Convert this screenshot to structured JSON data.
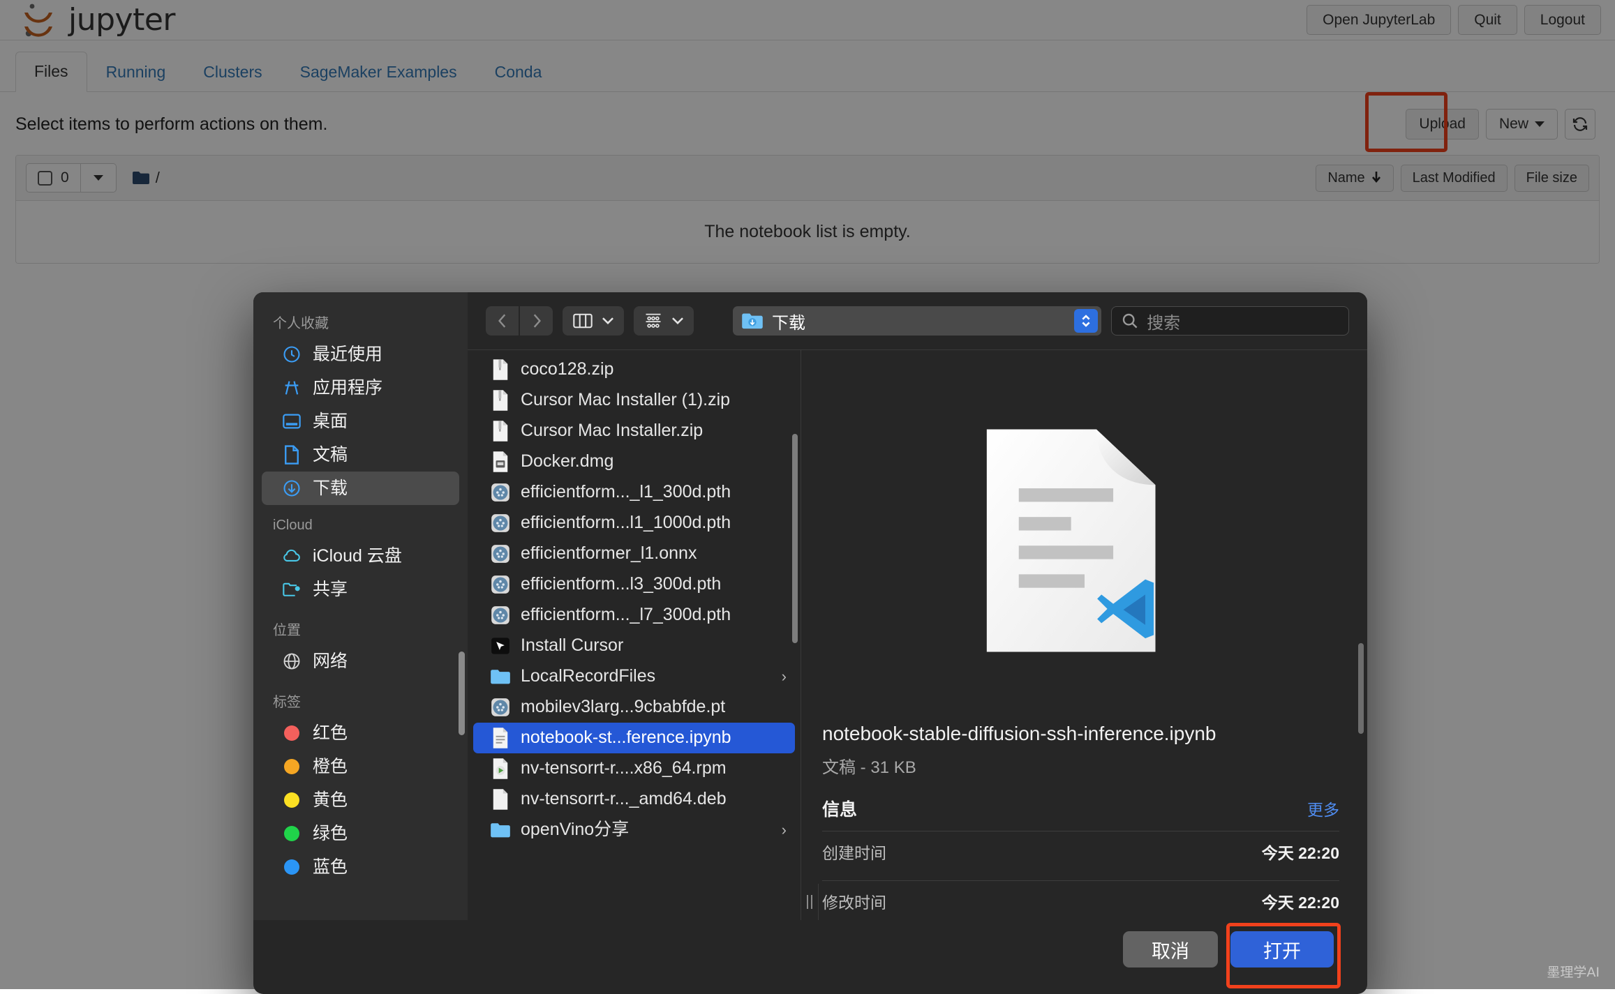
{
  "jupyter": {
    "brand": "jupyter",
    "header_buttons": [
      {
        "label": "Open JupyterLab",
        "name": "open-jupyterlab-button"
      },
      {
        "label": "Quit",
        "name": "quit-button"
      },
      {
        "label": "Logout",
        "name": "logout-button"
      }
    ],
    "tabs": [
      {
        "label": "Files",
        "active": true
      },
      {
        "label": "Running",
        "active": false
      },
      {
        "label": "Clusters",
        "active": false
      },
      {
        "label": "SageMaker Examples",
        "active": false
      },
      {
        "label": "Conda",
        "active": false
      }
    ],
    "hint": "Select items to perform actions on them.",
    "upload_label": "Upload",
    "new_label": "New",
    "refresh_icon": "refresh-icon",
    "selection_count": "0",
    "breadcrumb_path": "/",
    "sort_buttons": [
      {
        "label": "Name",
        "sorted": true
      },
      {
        "label": "Last Modified",
        "sorted": false
      },
      {
        "label": "File size",
        "sorted": false
      }
    ],
    "empty_message": "The notebook list is empty.",
    "highlight_color": "#f1411c"
  },
  "dialog": {
    "sidebar": {
      "groups": [
        {
          "title": "个人收藏",
          "items": [
            {
              "label": "最近使用",
              "icon": "clock-icon",
              "selected": false
            },
            {
              "label": "应用程序",
              "icon": "applications-icon",
              "selected": false
            },
            {
              "label": "桌面",
              "icon": "desktop-icon",
              "selected": false
            },
            {
              "label": "文稿",
              "icon": "document-icon",
              "selected": false
            },
            {
              "label": "下载",
              "icon": "download-icon",
              "selected": true
            }
          ]
        },
        {
          "title": "iCloud",
          "items": [
            {
              "label": "iCloud 云盘",
              "icon": "cloud-icon",
              "selected": false
            },
            {
              "label": "共享",
              "icon": "shared-folder-icon",
              "selected": false
            }
          ]
        },
        {
          "title": "位置",
          "items": [
            {
              "label": "网络",
              "icon": "globe-icon",
              "selected": false
            }
          ]
        },
        {
          "title": "标签",
          "items": [
            {
              "label": "红色",
              "icon": "tag-dot",
              "color": "#f4605c",
              "selected": false
            },
            {
              "label": "橙色",
              "icon": "tag-dot",
              "color": "#f5a623",
              "selected": false
            },
            {
              "label": "黄色",
              "icon": "tag-dot",
              "color": "#fbe023",
              "selected": false
            },
            {
              "label": "绿色",
              "icon": "tag-dot",
              "color": "#20d44a",
              "selected": false
            },
            {
              "label": "蓝色",
              "icon": "tag-dot",
              "color": "#2b95f5",
              "selected": false
            }
          ]
        }
      ]
    },
    "toolbar": {
      "back_icon": "chevron-left-icon",
      "forward_icon": "chevron-right-icon",
      "view_icon": "column-view-icon",
      "group_icon": "group-by-icon",
      "path_label": "下载",
      "path_icon": "download-folder-icon",
      "search_placeholder": "搜索",
      "search_value": "",
      "search_icon": "search-icon"
    },
    "files": [
      {
        "name": "coco128.zip",
        "icon": "zip-file-icon",
        "selected": false,
        "has_chevron": false
      },
      {
        "name": "Cursor Mac Installer (1).zip",
        "icon": "zip-file-icon",
        "selected": false,
        "has_chevron": false
      },
      {
        "name": "Cursor Mac Installer.zip",
        "icon": "zip-file-icon",
        "selected": false,
        "has_chevron": false
      },
      {
        "name": "Docker.dmg",
        "icon": "dmg-file-icon",
        "selected": false,
        "has_chevron": false
      },
      {
        "name": "efficientform..._l1_300d.pth",
        "icon": "pth-file-icon",
        "selected": false,
        "has_chevron": false
      },
      {
        "name": "efficientform...l1_1000d.pth",
        "icon": "pth-file-icon",
        "selected": false,
        "has_chevron": false
      },
      {
        "name": "efficientformer_l1.onnx",
        "icon": "pth-file-icon",
        "selected": false,
        "has_chevron": false
      },
      {
        "name": "efficientform...l3_300d.pth",
        "icon": "pth-file-icon",
        "selected": false,
        "has_chevron": false
      },
      {
        "name": "efficientform..._l7_300d.pth",
        "icon": "pth-file-icon",
        "selected": false,
        "has_chevron": false
      },
      {
        "name": "Install Cursor",
        "icon": "install-cursor-icon",
        "selected": false,
        "has_chevron": false
      },
      {
        "name": "LocalRecordFiles",
        "icon": "folder-icon",
        "selected": false,
        "has_chevron": true
      },
      {
        "name": "mobilev3larg...9cbabfde.pt",
        "icon": "pth-file-icon",
        "selected": false,
        "has_chevron": false
      },
      {
        "name": "notebook-st...ference.ipynb",
        "icon": "text-file-icon",
        "selected": true,
        "has_chevron": false
      },
      {
        "name": "nv-tensorrt-r....x86_64.rpm",
        "icon": "rpm-file-icon",
        "selected": false,
        "has_chevron": false
      },
      {
        "name": "nv-tensorrt-r..._amd64.deb",
        "icon": "deb-file-icon",
        "selected": false,
        "has_chevron": false
      },
      {
        "name": "openVino分享",
        "icon": "folder-icon",
        "selected": false,
        "has_chevron": true
      }
    ],
    "preview": {
      "thumbnail_icon": "vscode-document-icon",
      "title": "notebook-stable-diffusion-ssh-inference.ipynb",
      "subtitle": "文稿 - 31 KB",
      "info_title": "信息",
      "more_label": "更多",
      "rows": [
        {
          "key": "创建时间",
          "value": "今天 22:20"
        },
        {
          "key": "修改时间",
          "value": "今天 22:20"
        }
      ]
    },
    "footer": {
      "cancel_label": "取消",
      "open_label": "打开"
    }
  },
  "watermark": "墨理学AI"
}
